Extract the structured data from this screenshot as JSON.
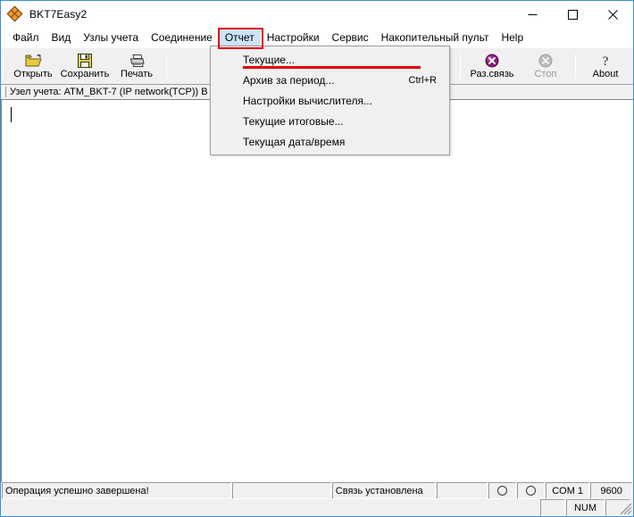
{
  "window": {
    "title": "BKT7Easy2",
    "icon": "diamond-cluster-icon",
    "controls": {
      "minimize": "minimize-icon",
      "maximize": "maximize-icon",
      "close": "close-icon"
    }
  },
  "menubar": {
    "items": [
      {
        "label": "Файл",
        "name": "menu-file"
      },
      {
        "label": "Вид",
        "name": "menu-view"
      },
      {
        "label": "Узлы учета",
        "name": "menu-nodes"
      },
      {
        "label": "Соединение",
        "name": "menu-connection"
      },
      {
        "label": "Отчет",
        "name": "menu-report",
        "active": true,
        "highlighted": true
      },
      {
        "label": "Настройки",
        "name": "menu-settings"
      },
      {
        "label": "Сервис",
        "name": "menu-service"
      },
      {
        "label": "Накопительный пульт",
        "name": "menu-accumulator"
      },
      {
        "label": "Help",
        "name": "menu-help"
      }
    ]
  },
  "dropdown": {
    "open": true,
    "parent": "Отчет",
    "items": [
      {
        "label": "Текущие...",
        "shortcut": "",
        "underlined": true
      },
      {
        "label": "Архив за период...",
        "shortcut": "Ctrl+R",
        "underlined": false
      },
      {
        "label": "Настройки вычислителя...",
        "shortcut": "",
        "underlined": false
      },
      {
        "label": "Текущие итоговые...",
        "shortcut": "",
        "underlined": false
      },
      {
        "label": "Текущая дата/время",
        "shortcut": "",
        "underlined": false
      }
    ]
  },
  "toolbar": {
    "left": [
      {
        "label": "Открыть",
        "icon": "open-folder-icon",
        "disabled": false
      },
      {
        "label": "Сохранить",
        "icon": "save-floppy-icon",
        "disabled": false
      },
      {
        "label": "Печать",
        "icon": "printer-icon",
        "disabled": false
      }
    ],
    "right": [
      {
        "label": "Раз.связь",
        "icon": "disconnect-icon",
        "disabled": false
      },
      {
        "label": "Стоп",
        "icon": "stop-icon",
        "disabled": true
      },
      {
        "label": "About",
        "icon": "help-question-icon",
        "disabled": false
      }
    ]
  },
  "infobar": {
    "text": "Узел учета: ATM_BKT-7   (IP network(TCP)) B"
  },
  "statusbar": {
    "message": "Операция успешно завершена!",
    "empty_cell": "",
    "connection": "Связь установлена",
    "spacer": "",
    "led_rx": "led-indicator-rx",
    "led_tx": "led-indicator-tx",
    "port": "COM 1",
    "baud": "9600",
    "num_lock": "NUM"
  },
  "colors": {
    "window_border": "#3b8fd4",
    "highlight_red": "#e00000",
    "menu_active_bg": "#cce4f7",
    "chrome_bg": "#f0f0f0",
    "disconnect_icon": "#8b1a7a"
  }
}
